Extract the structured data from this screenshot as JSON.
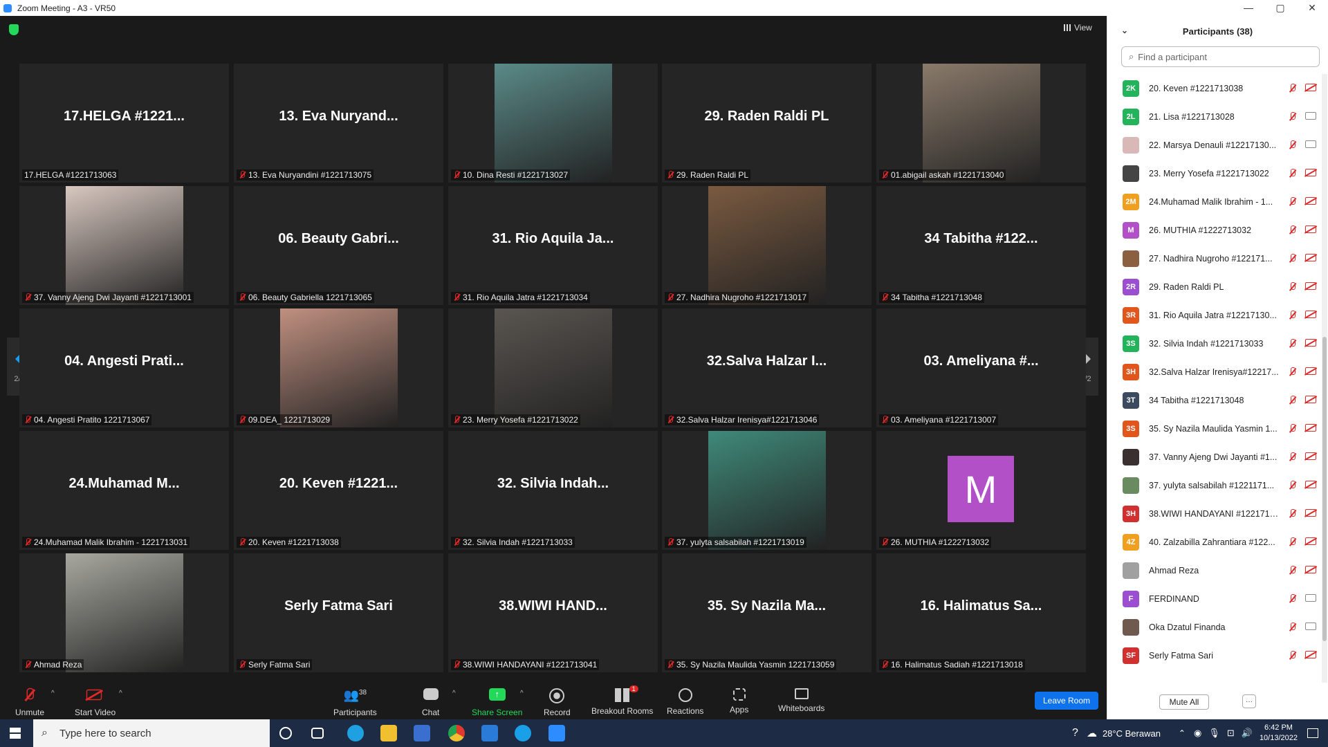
{
  "window": {
    "title": "Zoom Meeting - A3 - VR50",
    "min": "—",
    "max": "▢",
    "close": "✕"
  },
  "view_label": "View",
  "page_indicator": "2/2",
  "tiles": [
    {
      "big": "17.HELGA #1221...",
      "name": "17.HELGA #1221713063",
      "muted": false
    },
    {
      "big": "13. Eva Nuryand...",
      "name": "13. Eva Nuryandini #1221713075",
      "muted": true
    },
    {
      "big": "",
      "name": "10. Dina Resti #1221713027",
      "muted": true,
      "photo": "#5a8a88"
    },
    {
      "big": "29. Raden Raldi PL",
      "name": "29. Raden Raldi PL",
      "muted": true
    },
    {
      "big": "",
      "name": "01.abigail askah #1221713040",
      "muted": true,
      "photo": "#8a7a6a"
    },
    {
      "big": "",
      "name": "37. Vanny Ajeng Dwi Jayanti #1221713001",
      "muted": true,
      "photo": "#d8c8c0"
    },
    {
      "big": "06. Beauty Gabri...",
      "name": "06. Beauty Gabriella 1221713065",
      "muted": true
    },
    {
      "big": "31. Rio Aquila Ja...",
      "name": "31. Rio Aquila Jatra #1221713034",
      "muted": true
    },
    {
      "big": "",
      "name": "27. Nadhira Nugroho #1221713017",
      "muted": true,
      "photo": "#7a5a40"
    },
    {
      "big": "34 Tabitha #122...",
      "name": "34 Tabitha #1221713048",
      "muted": true
    },
    {
      "big": "04. Angesti Prati...",
      "name": "04. Angesti Pratito 1221713067",
      "muted": true
    },
    {
      "big": "",
      "name": "09.DEA_ 1221713029",
      "muted": true,
      "photo": "#c09080"
    },
    {
      "big": "",
      "name": "23. Merry Yosefa #1221713022",
      "muted": true,
      "photo": "#5a5550"
    },
    {
      "big": "32.Salva Halzar I...",
      "name": "32.Salva Halzar Irenisya#1221713046",
      "muted": true
    },
    {
      "big": "03. Ameliyana #...",
      "name": "03. Ameliyana #1221713007",
      "muted": true
    },
    {
      "big": "24.Muhamad M...",
      "name": "24.Muhamad Malik Ibrahim - 1221713031",
      "muted": true
    },
    {
      "big": "20. Keven #1221...",
      "name": "20. Keven #1221713038",
      "muted": true
    },
    {
      "big": "32. Silvia Indah...",
      "name": "32. Silvia Indah #1221713033",
      "muted": true
    },
    {
      "big": "",
      "name": "37. yulyta salsabilah #1221713019",
      "muted": true,
      "photo": "#3f8a7a"
    },
    {
      "big": "M",
      "name": "26. MUTHIA #1222713032",
      "muted": true,
      "avatar": "#b250c7"
    },
    {
      "big": "",
      "name": "Ahmad Reza",
      "muted": true,
      "photo": "#a8a8a0"
    },
    {
      "big": "Serly Fatma Sari",
      "name": "Serly Fatma Sari",
      "muted": true
    },
    {
      "big": "38.WIWI HAND...",
      "name": "38.WIWI HANDAYANI #1221713041",
      "muted": true
    },
    {
      "big": "35. Sy Nazila Ma...",
      "name": "35. Sy Nazila Maulida Yasmin 1221713059",
      "muted": true
    },
    {
      "big": "16. Halimatus Sa...",
      "name": "16. Halimatus Sadiah #1221713018",
      "muted": true
    }
  ],
  "toolbar": {
    "unmute": "Unmute",
    "start_video": "Start Video",
    "participants": "Participants",
    "participants_count": "38",
    "chat": "Chat",
    "share_screen": "Share Screen",
    "record": "Record",
    "breakout_rooms": "Breakout Rooms",
    "breakout_badge": "1",
    "reactions": "Reactions",
    "apps": "Apps",
    "whiteboards": "Whiteboards",
    "leave": "Leave Room"
  },
  "panel": {
    "title": "Participants (38)",
    "search_placeholder": "Find a participant",
    "mute_all": "Mute All",
    "more": "···",
    "participants": [
      {
        "initials": "2K",
        "color": "#23b35a",
        "name": "20. Keven #1221713038",
        "cam": false
      },
      {
        "initials": "2L",
        "color": "#23b35a",
        "name": "21. Lisa #1221713028",
        "cam": true
      },
      {
        "initials": "",
        "color": "#d9b8b8",
        "name": "22. Marsya Denauli #12217130...",
        "cam": true
      },
      {
        "initials": "",
        "color": "#444444",
        "name": "23. Merry Yosefa #1221713022",
        "cam": false
      },
      {
        "initials": "2M",
        "color": "#f0a020",
        "name": "24.Muhamad Malik Ibrahim - 1...",
        "cam": false
      },
      {
        "initials": "M",
        "color": "#b250c7",
        "name": "26. MUTHIA #1222713032",
        "cam": false
      },
      {
        "initials": "",
        "color": "#8a6040",
        "name": "27. Nadhira Nugroho #122171...",
        "cam": false
      },
      {
        "initials": "2R",
        "color": "#9b4fd0",
        "name": "29. Raden Raldi PL",
        "cam": false
      },
      {
        "initials": "3R",
        "color": "#e0561c",
        "name": "31. Rio Aquila Jatra #12217130...",
        "cam": false
      },
      {
        "initials": "3S",
        "color": "#23b35a",
        "name": "32. Silvia Indah #1221713033",
        "cam": false
      },
      {
        "initials": "3H",
        "color": "#e0561c",
        "name": "32.Salva Halzar Irenisya#12217...",
        "cam": false
      },
      {
        "initials": "3T",
        "color": "#3b4a5e",
        "name": "34 Tabitha #1221713048",
        "cam": false
      },
      {
        "initials": "3S",
        "color": "#e0561c",
        "name": "35. Sy Nazila Maulida Yasmin 1...",
        "cam": false
      },
      {
        "initials": "",
        "color": "#3a3030",
        "name": "37. Vanny Ajeng Dwi Jayanti #1...",
        "cam": false
      },
      {
        "initials": "",
        "color": "#6a8a60",
        "name": "37. yulyta salsabilah #1221171...",
        "cam": false
      },
      {
        "initials": "3H",
        "color": "#d03030",
        "name": "38.WIWI HANDAYANI #1221713...",
        "cam": false
      },
      {
        "initials": "4Z",
        "color": "#f0a020",
        "name": "40. Zalzabilla Zahrantiara #122...",
        "cam": false
      },
      {
        "initials": "",
        "color": "#a0a0a0",
        "name": "Ahmad Reza",
        "cam": false
      },
      {
        "initials": "F",
        "color": "#9b4fd0",
        "name": "FERDINAND",
        "cam": true
      },
      {
        "initials": "",
        "color": "#705a50",
        "name": "Oka Dzatul Finanda",
        "cam": true
      },
      {
        "initials": "SF",
        "color": "#d03030",
        "name": "Serly Fatma Sari",
        "cam": false
      }
    ]
  },
  "taskbar": {
    "search_placeholder": "Type here to search",
    "weather": "28°C Berawan",
    "time": "6:42 PM",
    "date": "10/13/2022"
  }
}
